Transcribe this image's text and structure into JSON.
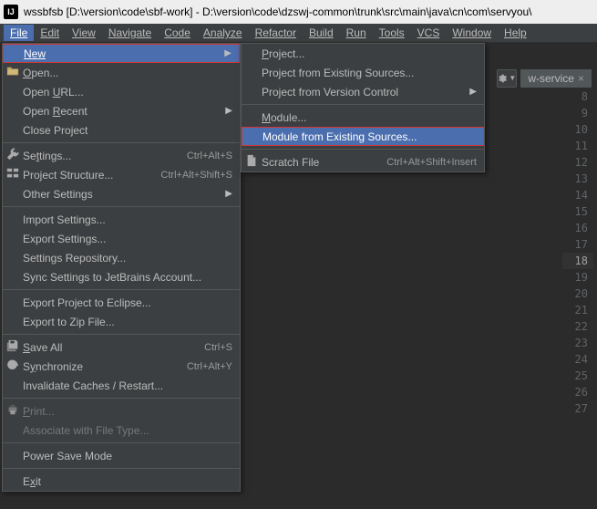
{
  "title_bar": {
    "icon_label": "IJ",
    "text": "wssbfsb [D:\\version\\code\\sbf-work] - D:\\version\\code\\dzswj-common\\trunk\\src\\main\\java\\cn\\com\\servyou\\"
  },
  "menu_bar": {
    "items": [
      "File",
      "Edit",
      "View",
      "Navigate",
      "Code",
      "Analyze",
      "Refactor",
      "Build",
      "Run",
      "Tools",
      "VCS",
      "Window",
      "Help"
    ],
    "active": "File"
  },
  "file_menu": {
    "new": "New",
    "open": "Open...",
    "open_url": "Open URL...",
    "open_recent": "Open Recent",
    "close_project": "Close Project",
    "settings": "Settings...",
    "settings_sc": "Ctrl+Alt+S",
    "project_structure": "Project Structure...",
    "project_structure_sc": "Ctrl+Alt+Shift+S",
    "other_settings": "Other Settings",
    "import_settings": "Import Settings...",
    "export_settings": "Export Settings...",
    "settings_repo": "Settings Repository...",
    "sync_jetbrains": "Sync Settings to JetBrains Account...",
    "export_eclipse": "Export Project to Eclipse...",
    "export_zip": "Export to Zip File...",
    "save_all": "Save All",
    "save_all_sc": "Ctrl+S",
    "synchronize": "Synchronize",
    "synchronize_sc": "Ctrl+Alt+Y",
    "invalidate": "Invalidate Caches / Restart...",
    "print": "Print...",
    "associate": "Associate with File Type...",
    "power_save": "Power Save Mode",
    "exit": "Exit"
  },
  "new_submenu": {
    "project": "Project...",
    "project_existing": "Project from Existing Sources...",
    "project_vc": "Project from Version Control",
    "module": "Module...",
    "module_existing": "Module from Existing Sources...",
    "scratch": "Scratch File",
    "scratch_sc": "Ctrl+Alt+Shift+Insert"
  },
  "editor": {
    "visible_tab": "w-service",
    "line_numbers": [
      8,
      9,
      10,
      11,
      12,
      13,
      14,
      15,
      16,
      17,
      18,
      19,
      20,
      21,
      22,
      23,
      24,
      25,
      26,
      27
    ],
    "highlighted_line": 18
  }
}
